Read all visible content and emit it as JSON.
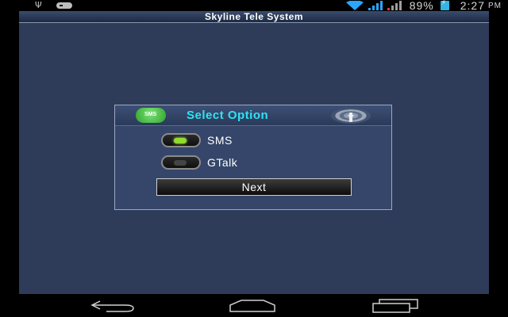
{
  "status_bar": {
    "icons": [
      "usb-icon",
      "gamepad-icon",
      "wifi-icon",
      "signal-icon",
      "signal-icon",
      "battery-icon"
    ],
    "battery": "89%",
    "time": "2:27",
    "ampm": "PM"
  },
  "app": {
    "title": "Skyline Tele System"
  },
  "dialog": {
    "title": "Select Option",
    "options": [
      {
        "label": "SMS",
        "selected": true
      },
      {
        "label": "GTalk",
        "selected": false
      }
    ],
    "next_label": "Next"
  },
  "colors": {
    "title_accent": "#2ee3f2",
    "background": "#2e3c5a",
    "radio_on": "#8fdb2f"
  },
  "nav_bar": {
    "buttons": [
      "back-icon",
      "home-icon",
      "recent-apps-icon"
    ]
  }
}
